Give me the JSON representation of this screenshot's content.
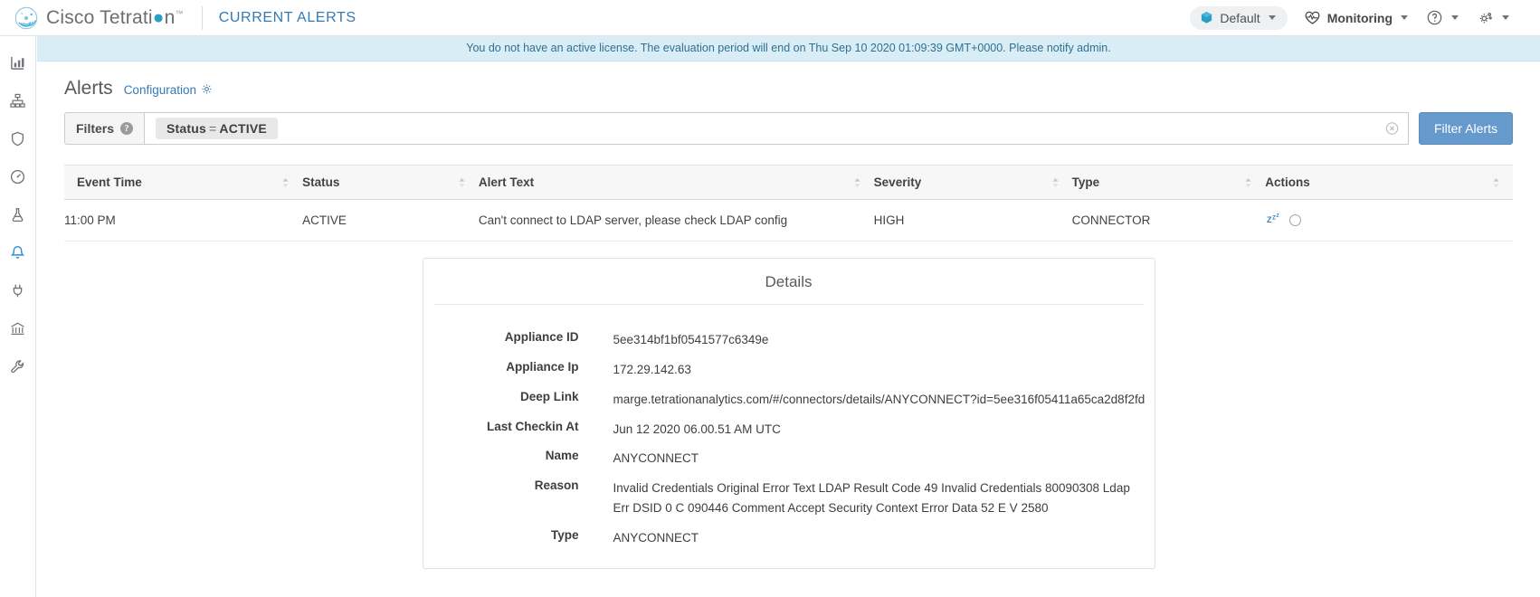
{
  "header": {
    "brand_name_before": "Cisco Tetrati",
    "brand_name_after": "n",
    "brand_tm": "™",
    "page_label": "CURRENT ALERTS",
    "scope": {
      "label": "Default",
      "icon": "cube-icon"
    },
    "menus": [
      {
        "label": "Monitoring",
        "icon": "heartbeat-icon"
      }
    ],
    "help_icon": "question-circle-icon",
    "settings_icon": "gear-icon"
  },
  "rail": {
    "items": [
      {
        "name": "sidebar-item-dashboard",
        "icon": "bar-chart-icon"
      },
      {
        "name": "sidebar-item-topology",
        "icon": "sitemap-icon"
      },
      {
        "name": "sidebar-item-security",
        "icon": "shield-icon"
      },
      {
        "name": "sidebar-item-monitoring",
        "icon": "gauge-icon"
      },
      {
        "name": "sidebar-item-forensics",
        "icon": "flask-icon"
      },
      {
        "name": "sidebar-item-alerts",
        "icon": "bell-icon",
        "active": true
      },
      {
        "name": "sidebar-item-connectors",
        "icon": "plug-icon"
      },
      {
        "name": "sidebar-item-platform",
        "icon": "bank-icon"
      },
      {
        "name": "sidebar-item-tools",
        "icon": "wrench-icon"
      }
    ]
  },
  "banner": {
    "text": "You do not have an active license. The evaluation period will end on Thu Sep 10 2020 01:09:39 GMT+0000.   Please notify admin."
  },
  "page": {
    "title": "Alerts",
    "configuration_link": "Configuration",
    "configuration_icon": "gear-icon"
  },
  "filters": {
    "label": "Filters",
    "help_icon": "question-mark-icon",
    "chip": {
      "field": "Status",
      "operator": "=",
      "value": "ACTIVE"
    },
    "clear_icon": "clear-circle-icon",
    "button_label": "Filter Alerts",
    "input_placeholder": ""
  },
  "table": {
    "columns": [
      {
        "label": "Event Time",
        "sortable": true
      },
      {
        "label": "Status",
        "sortable": true
      },
      {
        "label": "Alert Text",
        "sortable": true
      },
      {
        "label": "Severity",
        "sortable": true
      },
      {
        "label": "Type",
        "sortable": true
      },
      {
        "label": "Actions",
        "sortable": true
      }
    ],
    "rows": [
      {
        "event_time": "11:00 PM",
        "status": "ACTIVE",
        "alert_text": "Can't connect to LDAP server, please check LDAP config",
        "severity": "HIGH",
        "type": "CONNECTOR",
        "actions": {
          "snooze_label": "Z",
          "snooze_sup": "ZZ",
          "snooze_icon": "snooze-icon",
          "close_icon": "circle-icon"
        }
      }
    ]
  },
  "details": {
    "title": "Details",
    "fields": [
      {
        "label": "Appliance ID",
        "value": "5ee314bf1bf0541577c6349e"
      },
      {
        "label": "Appliance Ip",
        "value": "172.29.142.63"
      },
      {
        "label": "Deep Link",
        "value": "marge.tetrationanalytics.com/#/connectors/details/ANYCONNECT?id=5ee316f05411a65ca2d8f2fd"
      },
      {
        "label": "Last Checkin At",
        "value": "Jun 12 2020 06.00.51 AM UTC"
      },
      {
        "label": "Name",
        "value": "ANYCONNECT"
      },
      {
        "label": "Reason",
        "value": "Invalid Credentials Original Error Text LDAP Result Code 49 Invalid Credentials 80090308 Ldap Err DSID 0 C 090446 Comment Accept Security Context Error Data 52 E V 2580"
      },
      {
        "label": "Type",
        "value": "ANYCONNECT"
      }
    ]
  },
  "colors": {
    "accent": "#337ab7",
    "banner_bg": "#d9edf7",
    "banner_text": "#31708f",
    "filter_button": "#6699cc",
    "brand_gray": "#6a6f73"
  }
}
